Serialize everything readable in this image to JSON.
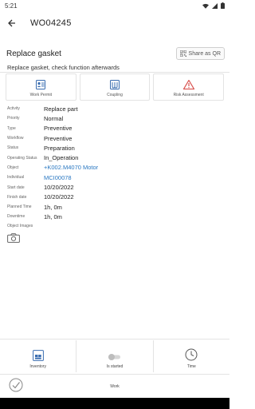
{
  "status_bar": {
    "time": "5:21",
    "icons": [
      "wifi-icon",
      "signal-icon",
      "battery-icon"
    ]
  },
  "appbar": {
    "title": "WO04245",
    "back_icon": "arrow-left-icon"
  },
  "header": {
    "title": "Replace gasket",
    "share_label": "Share as QR"
  },
  "description": "Replace gasket, check function afterwards",
  "cards": [
    {
      "label": "Work Permit",
      "icon": "work-permit-icon"
    },
    {
      "label": "Coupling",
      "icon": "coupling-icon"
    },
    {
      "label": "Risk Assessment",
      "icon": "warning-icon"
    }
  ],
  "properties": [
    {
      "key": "Activity",
      "value": "Replace part",
      "link": false
    },
    {
      "key": "Priority",
      "value": "Normal",
      "link": false
    },
    {
      "key": "Type",
      "value": "Preventive",
      "link": false
    },
    {
      "key": "Workflow",
      "value": "Preventive",
      "link": false
    },
    {
      "key": "Status",
      "value": "Preparation",
      "link": false
    },
    {
      "key": "Operating Status",
      "value": "In_Operation",
      "link": false
    },
    {
      "key": "Object",
      "value": "+K002.M4070 Motor",
      "link": true
    },
    {
      "key": "Individual",
      "value": "MCI00078",
      "link": true
    },
    {
      "key": "Start date",
      "value": "10/20/2022",
      "link": false
    },
    {
      "key": "Finish date",
      "value": "10/20/2022",
      "link": false
    },
    {
      "key": "Planned Time",
      "value": "1h, 0m",
      "link": false
    },
    {
      "key": "Downtime",
      "value": "1h, 0m",
      "link": false
    }
  ],
  "object_images": {
    "label": "Object Images",
    "icon": "camera-icon"
  },
  "bottom_actions": [
    {
      "label": "Inventory",
      "icon": "inventory-icon"
    },
    {
      "label": "Is started",
      "icon": "toggle-icon",
      "toggle_on": false
    },
    {
      "label": "Time",
      "icon": "clock-icon"
    }
  ],
  "footer": {
    "label": "Work",
    "check_icon": "check-circle-icon"
  },
  "colors": {
    "link": "#2a78c2",
    "warning": "#d9534f",
    "accent": "#2a78c2"
  }
}
